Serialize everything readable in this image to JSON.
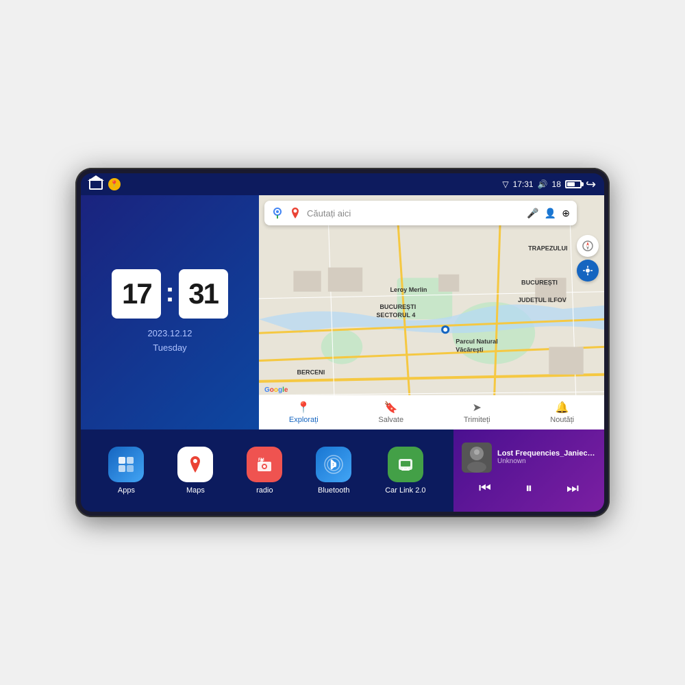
{
  "device": {
    "status_bar": {
      "time": "17:31",
      "battery_level": "18",
      "signal": "▼"
    },
    "clock": {
      "hours": "17",
      "minutes": "31",
      "date": "2023.12.12",
      "day": "Tuesday"
    },
    "map": {
      "search_placeholder": "Căutați aici",
      "nav_items": [
        {
          "label": "Explorați",
          "icon": "📍",
          "active": true
        },
        {
          "label": "Salvate",
          "icon": "🔖",
          "active": false
        },
        {
          "label": "Trimiteți",
          "icon": "➤",
          "active": false
        },
        {
          "label": "Noutăți",
          "icon": "🔔",
          "active": false
        }
      ],
      "labels": [
        "TRAPEZULUI",
        "BUCUREȘTI",
        "JUDEȚUL ILFOV",
        "BERCENI",
        "Parcul Natural Văcărești",
        "Leroy Merlin",
        "BUCUREȘTI\nSECTORUL 4"
      ]
    },
    "apps": [
      {
        "id": "apps",
        "label": "Apps",
        "icon": "⊞",
        "bg": "apps-bg"
      },
      {
        "id": "maps",
        "label": "Maps",
        "icon": "🗺",
        "bg": "maps-bg"
      },
      {
        "id": "radio",
        "label": "radio",
        "icon": "📻",
        "bg": "radio-bg"
      },
      {
        "id": "bluetooth",
        "label": "Bluetooth",
        "icon": "🔵",
        "bg": "bt-bg"
      },
      {
        "id": "carlink",
        "label": "Car Link 2.0",
        "icon": "📱",
        "bg": "carlink-bg"
      }
    ],
    "music": {
      "track_name": "Lost Frequencies_Janieck Devy-...",
      "artist": "Unknown",
      "controls": {
        "prev": "⏮",
        "play": "⏸",
        "next": "⏭"
      }
    }
  }
}
